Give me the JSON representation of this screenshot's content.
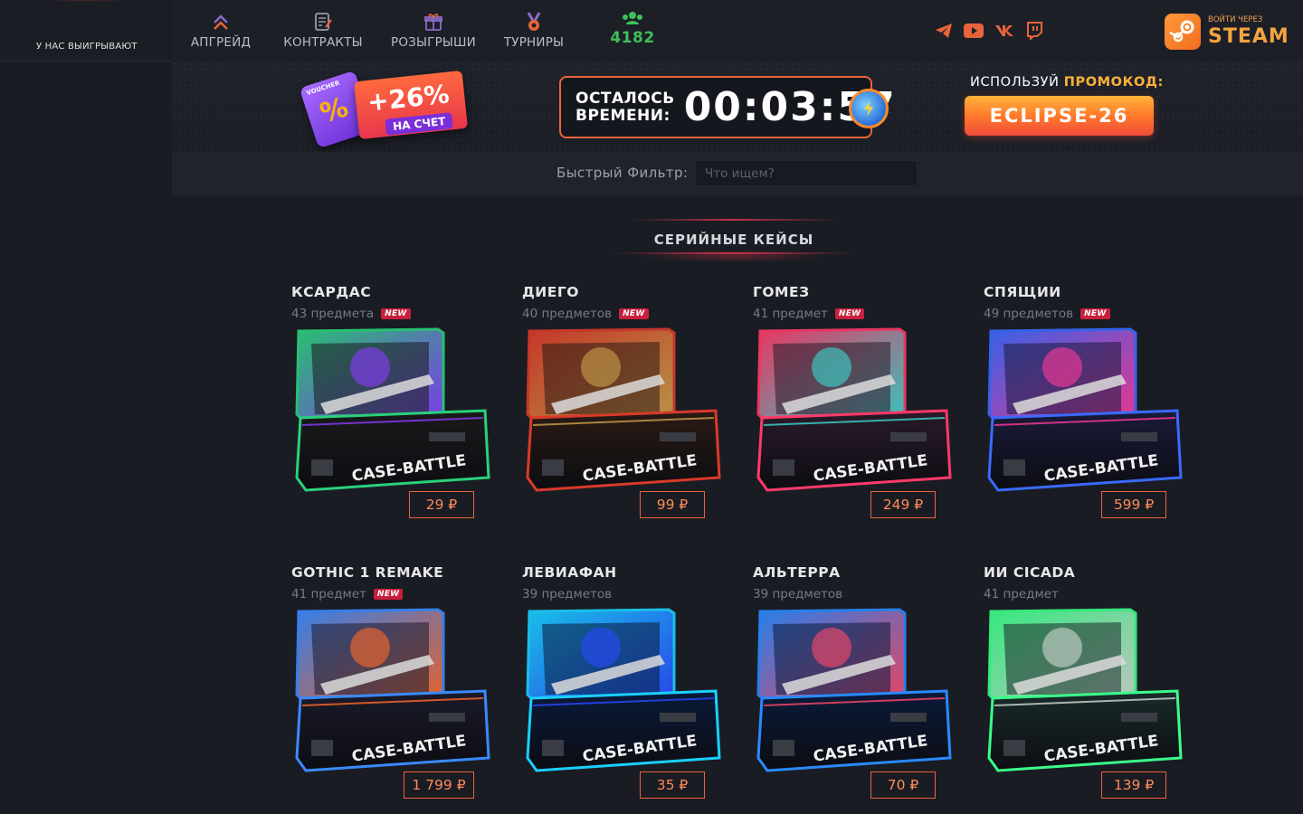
{
  "sidebar": {
    "winners_label": "У НАС ВЫИГРЫВАЮТ"
  },
  "nav": {
    "items": [
      {
        "label": "АПГРЕЙД",
        "icon": "chevrons-up-icon"
      },
      {
        "label": "КОНТРАКТЫ",
        "icon": "contract-icon"
      },
      {
        "label": "РОЗЫГРЫШИ",
        "icon": "gift-icon"
      },
      {
        "label": "ТУРНИРЫ",
        "icon": "medal-icon"
      }
    ],
    "online_count": "4182",
    "online_icon": "users-icon"
  },
  "socials": [
    "telegram-icon",
    "youtube-icon",
    "vk-icon",
    "twitch-icon"
  ],
  "login": {
    "small": "ВОЙТИ ЧЕРЕЗ",
    "big": "STEAM"
  },
  "banner": {
    "voucher": {
      "tag": "VOUCHER",
      "percent": "%",
      "bonus": "+26%",
      "caption": "НА СЧЕТ"
    },
    "timer": {
      "label_line1": "ОСТАЛОСЬ",
      "label_line2": "ВРЕМЕНИ:",
      "time": "00:03:57"
    },
    "promo": {
      "label_prefix": "ИСПОЛЬЗУЙ",
      "label_bold": "ПРОМОКОД:",
      "code": "ECLIPSE-26"
    }
  },
  "filter": {
    "label": "Быстрый Фильтр:",
    "placeholder": "Что ищем?"
  },
  "section_title": "СЕРИЙНЫЕ КЕЙСЫ",
  "cases": [
    {
      "name": "КСАРДАС",
      "count": "43 предмета",
      "new": "NEW",
      "price": "29 ₽",
      "colors": [
        "#2ad17a",
        "#8a3cff",
        "#1a1a1a"
      ]
    },
    {
      "name": "ДИЕГО",
      "count": "40 предметов",
      "new": "NEW",
      "price": "99 ₽",
      "colors": [
        "#d83a2a",
        "#c9a24a",
        "#2a1a14"
      ]
    },
    {
      "name": "ГОМЕЗ",
      "count": "41 предмет",
      "new": "NEW",
      "price": "249 ₽",
      "colors": [
        "#ff3a6a",
        "#3ad8d0",
        "#2a1a2a"
      ]
    },
    {
      "name": "СПЯЩИИ",
      "count": "49 предметов",
      "new": "NEW",
      "price": "599 ₽",
      "colors": [
        "#3a6aff",
        "#ff3a9a",
        "#1a1a3a"
      ]
    },
    {
      "name": "GOTHIC 1 REMAKE",
      "count": "41 предмет",
      "new": "NEW",
      "price": "1 799 ₽",
      "colors": [
        "#3a8aff",
        "#ff6a2a",
        "#1a1a2a"
      ]
    },
    {
      "name": "ЛЕВИАФАН",
      "count": "39 предметов",
      "new": "",
      "price": "35 ₽",
      "colors": [
        "#1ad0ff",
        "#2a4aff",
        "#0a1a3a"
      ]
    },
    {
      "name": "АЛЬТЕРРА",
      "count": "39 предметов",
      "new": "",
      "price": "70 ₽",
      "colors": [
        "#2a8aff",
        "#ff4a6a",
        "#0a1a3a"
      ]
    },
    {
      "name": "ИИ CICADA",
      "count": "41 предмет",
      "new": "",
      "price": "139 ₽",
      "colors": [
        "#3aff8a",
        "#d0d8d0",
        "#1a2a2a"
      ]
    }
  ],
  "case_label": "CASE-BATTLE"
}
